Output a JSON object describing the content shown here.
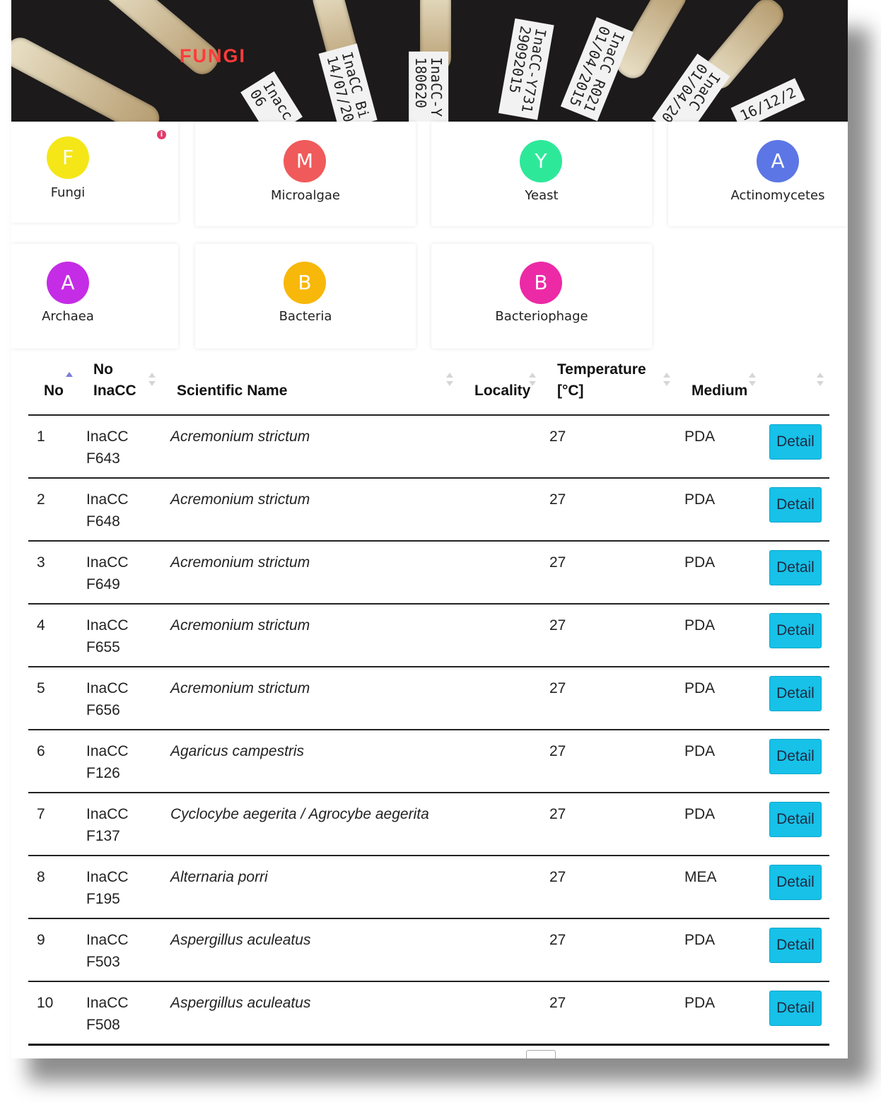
{
  "banner": {
    "title": "FUNGI",
    "tube_labels": [
      "Inacc\n06",
      "InaCC Bi\n14/07/20",
      "InaCC-Y\n180620",
      "InaCC-Y731\n29092015",
      "InaCC R021\n01/04/2015",
      "InaCC\n01/04/20",
      "16/12/2"
    ]
  },
  "categories": [
    {
      "letter": "F",
      "name": "Fungi",
      "color": "#f5e618"
    },
    {
      "letter": "M",
      "name": "Microalgae",
      "color": "#f05a5a"
    },
    {
      "letter": "Y",
      "name": "Yeast",
      "color": "#2ee89a"
    },
    {
      "letter": "A",
      "name": "Actinomycetes",
      "color": "#5c76e6"
    },
    {
      "letter": "A",
      "name": "Archaea",
      "color": "#c52ce6"
    },
    {
      "letter": "B",
      "name": "Bacteria",
      "color": "#f7b80a"
    },
    {
      "letter": "B",
      "name": "Bacteriophage",
      "color": "#ec2aa6"
    }
  ],
  "active_info_badge": "i",
  "table": {
    "headers": {
      "no": "No",
      "no_inacc_1": "No",
      "no_inacc_2": "InaCC",
      "scientific_name": "Scientific Name",
      "locality": "Locality",
      "temperature_1": "Temperature",
      "temperature_2": "[°C]",
      "medium": "Medium"
    },
    "detail_label": "Detail",
    "rows": [
      {
        "no": "1",
        "inacc_1": "InaCC",
        "inacc_2": "F643",
        "name": "Acremonium strictum",
        "locality": "",
        "temp": "27",
        "medium": "PDA"
      },
      {
        "no": "2",
        "inacc_1": "InaCC",
        "inacc_2": "F648",
        "name": "Acremonium strictum",
        "locality": "",
        "temp": "27",
        "medium": "PDA"
      },
      {
        "no": "3",
        "inacc_1": "InaCC",
        "inacc_2": "F649",
        "name": "Acremonium strictum",
        "locality": "",
        "temp": "27",
        "medium": "PDA"
      },
      {
        "no": "4",
        "inacc_1": "InaCC",
        "inacc_2": "F655",
        "name": "Acremonium strictum",
        "locality": "",
        "temp": "27",
        "medium": "PDA"
      },
      {
        "no": "5",
        "inacc_1": "InaCC",
        "inacc_2": "F656",
        "name": "Acremonium strictum",
        "locality": "",
        "temp": "27",
        "medium": "PDA"
      },
      {
        "no": "6",
        "inacc_1": "InaCC",
        "inacc_2": "F126",
        "name": "Agaricus campestris",
        "locality": "",
        "temp": "27",
        "medium": "PDA"
      },
      {
        "no": "7",
        "inacc_1": "InaCC",
        "inacc_2": "F137",
        "name": "Cyclocybe aegerita / Agrocybe aegerita",
        "locality": "",
        "temp": "27",
        "medium": "PDA"
      },
      {
        "no": "8",
        "inacc_1": "InaCC",
        "inacc_2": "F195",
        "name": "Alternaria porri",
        "locality": "",
        "temp": "27",
        "medium": "MEA"
      },
      {
        "no": "9",
        "inacc_1": "InaCC",
        "inacc_2": "F503",
        "name": "Aspergillus aculeatus",
        "locality": "",
        "temp": "27",
        "medium": "PDA"
      },
      {
        "no": "10",
        "inacc_1": "InaCC",
        "inacc_2": "F508",
        "name": "Aspergillus aculeatus",
        "locality": "",
        "temp": "27",
        "medium": "PDA"
      }
    ]
  }
}
